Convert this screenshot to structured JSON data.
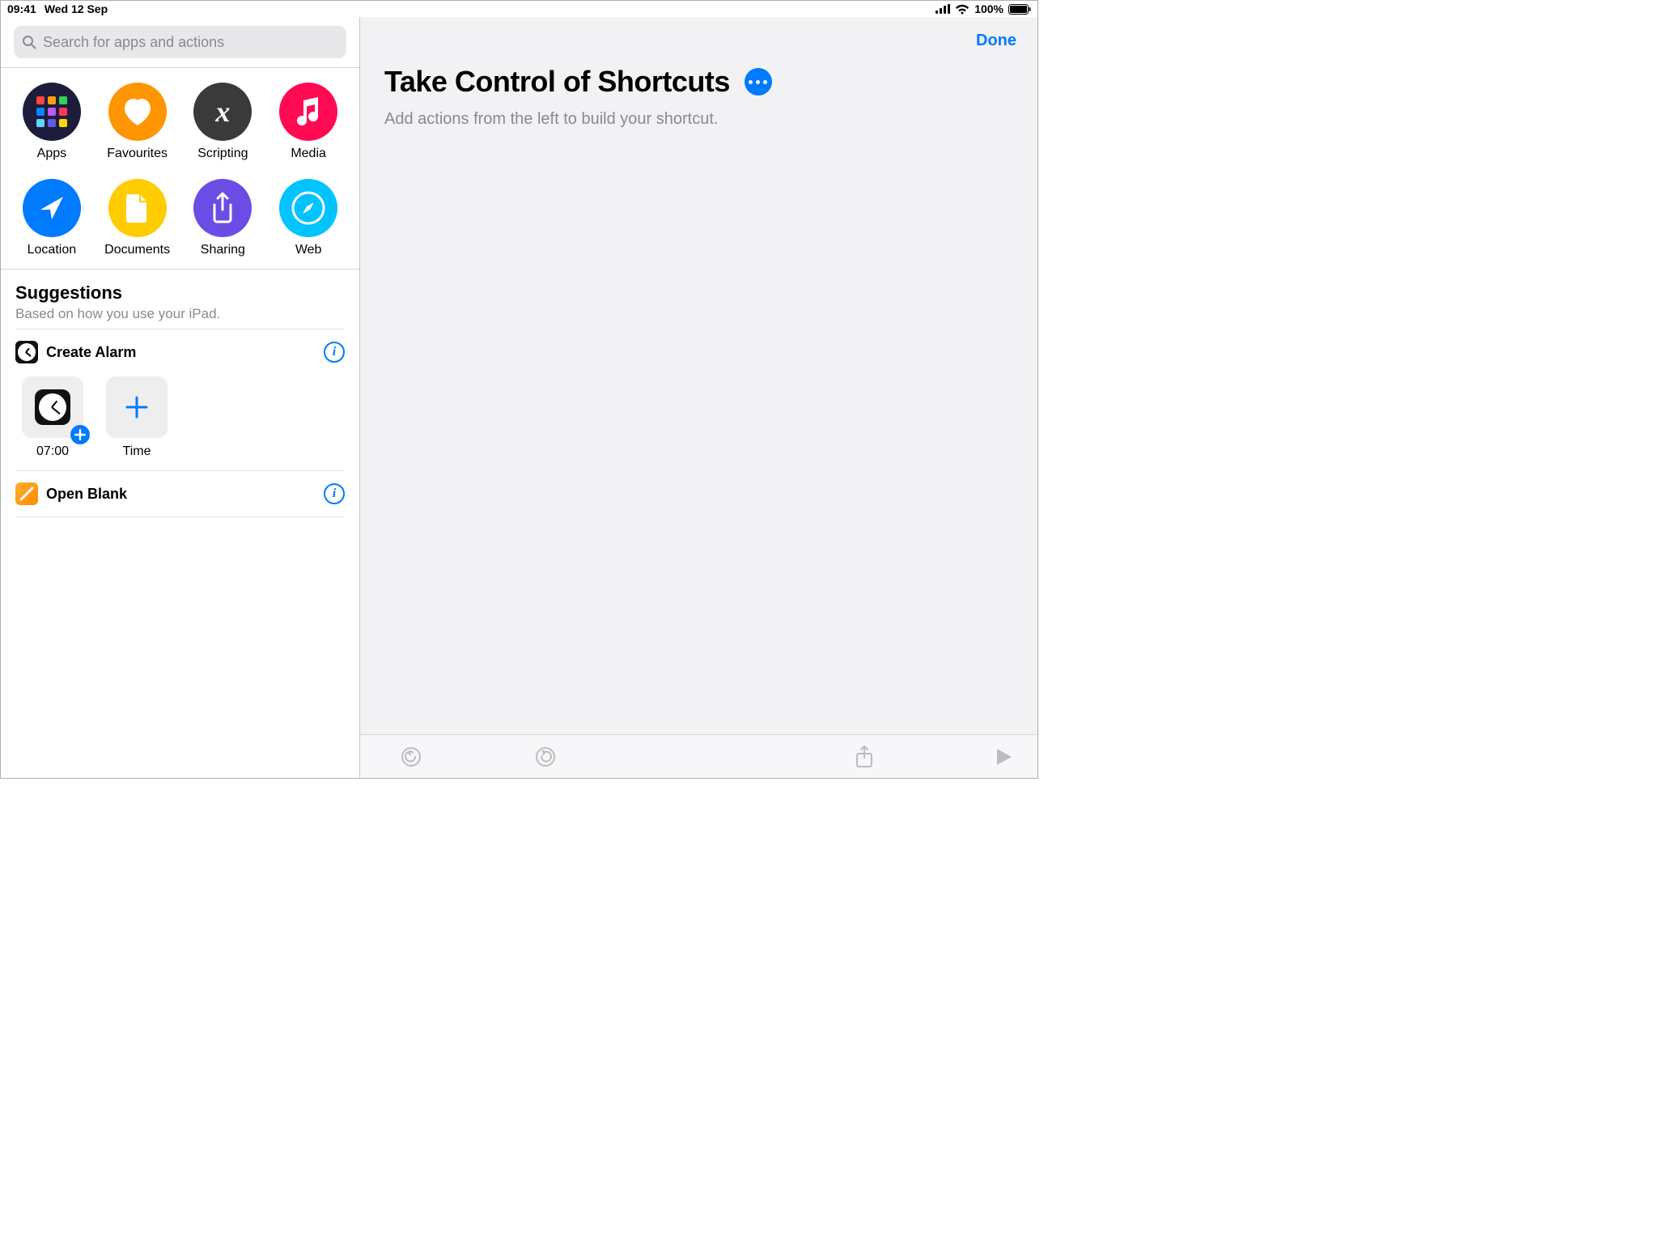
{
  "status": {
    "time": "09:41",
    "date": "Wed 12 Sep",
    "battery": "100%"
  },
  "search": {
    "placeholder": "Search for apps and actions"
  },
  "categories": [
    {
      "id": "apps",
      "label": "Apps"
    },
    {
      "id": "favourites",
      "label": "Favourites"
    },
    {
      "id": "scripting",
      "label": "Scripting"
    },
    {
      "id": "media",
      "label": "Media"
    },
    {
      "id": "location",
      "label": "Location"
    },
    {
      "id": "documents",
      "label": "Documents"
    },
    {
      "id": "sharing",
      "label": "Sharing"
    },
    {
      "id": "web",
      "label": "Web"
    }
  ],
  "suggestions": {
    "title": "Suggestions",
    "subtitle": "Based on how you use your iPad.",
    "items": [
      {
        "icon": "clock",
        "title": "Create Alarm",
        "cards": [
          {
            "kind": "preset",
            "label": "07:00"
          },
          {
            "kind": "custom",
            "label": "Time"
          }
        ]
      },
      {
        "icon": "pages",
        "title": "Open Blank",
        "cards": []
      }
    ]
  },
  "editor": {
    "done_label": "Done",
    "title": "Take Control of Shortcuts",
    "placeholder": "Add actions from the left to build your shortcut."
  },
  "colors": {
    "accent": "#007aff"
  }
}
